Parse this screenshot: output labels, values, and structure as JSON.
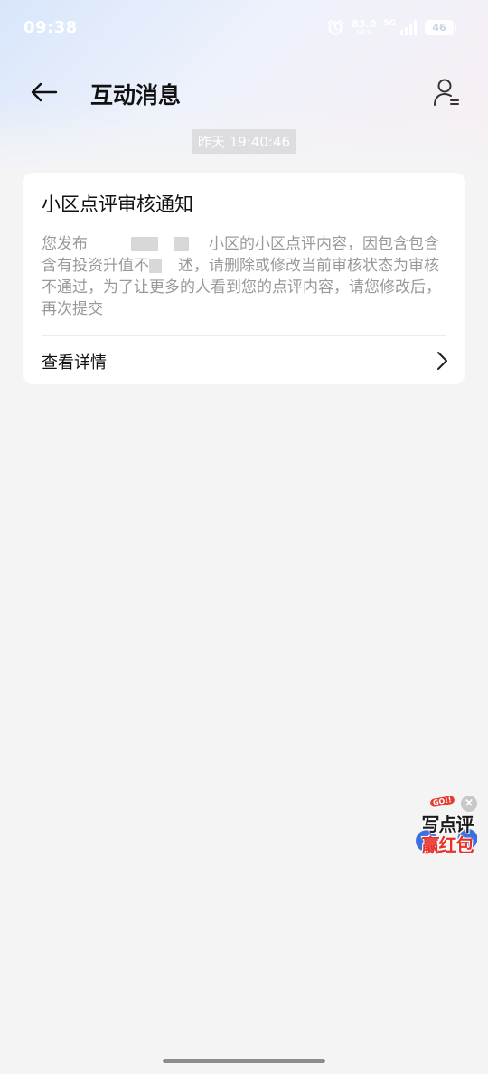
{
  "status_bar": {
    "time": "09:38",
    "net_speed_value": "83.0",
    "net_speed_unit": "KB/S",
    "network_type": "5G",
    "battery": "46"
  },
  "header": {
    "title": "互动消息"
  },
  "timestamp": "昨天 19:40:46",
  "message": {
    "title": "小区点评审核通知",
    "body_parts": {
      "p1": "您发布",
      "p2": "小区的小区点评内容，因包含包含含有投资升值不",
      "p3": "述，请删除或修改当前审核状态为审核不通过，为了让更多的人看到您的点评内容，请您修改后，再次提交"
    },
    "detail_label": "查看详情"
  },
  "promo": {
    "tag": "GO!!",
    "line1": "写点评",
    "line2": "赢红包"
  },
  "colors": {
    "background": "#f4f4f5",
    "card": "#ffffff",
    "body_text": "#999999",
    "promo_red": "#e8312a"
  }
}
